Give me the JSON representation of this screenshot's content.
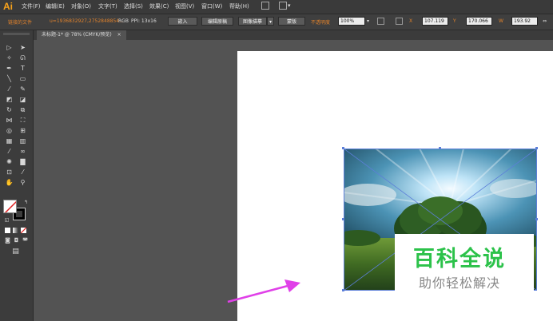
{
  "app": {
    "logo": "Ai"
  },
  "menu": [
    "文件(F)",
    "编辑(E)",
    "对象(O)",
    "文字(T)",
    "选择(S)",
    "效果(C)",
    "视图(V)",
    "窗口(W)",
    "帮助(H)"
  ],
  "control_bar": {
    "linked_file": "链接的文件",
    "file_name": "u=1936832927,2752848854...",
    "color_mode": "RGB",
    "ppi": "PPI: 13x16",
    "embed_btn": "嵌入",
    "edit_original_btn": "编辑原稿",
    "image_trace_btn": "图像描摹",
    "mask_btn": "蒙版",
    "opacity_label": "不透明度",
    "opacity_value": "100%",
    "x_value": "107.119",
    "y_value": "170.066",
    "w_value": "193.92"
  },
  "document_tab": {
    "label": "未标题-1* @ 78% (CMYK/预览)",
    "close": "×"
  },
  "watermark": {
    "title": "百科全说",
    "subtitle": "助你轻松解决"
  },
  "colors": {
    "accent_orange": "#e0822c",
    "selection_blue": "#5c7fd8",
    "arrow_magenta": "#e040e8",
    "watermark_green": "#2cc24a"
  }
}
